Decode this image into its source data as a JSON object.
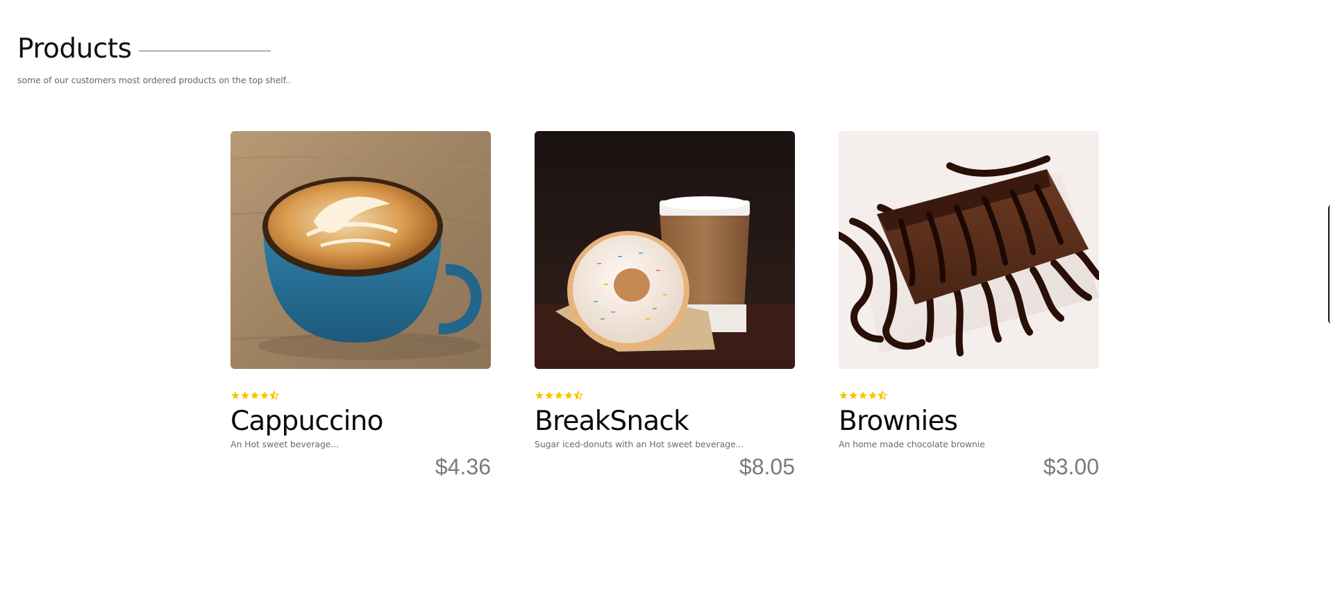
{
  "section": {
    "title": "Products",
    "subtitle": "some of our customers most ordered products on the top shelf.."
  },
  "colors": {
    "star": "#f5c400",
    "price": "#7a7a7a",
    "title": "#111111",
    "muted": "#666666"
  },
  "products": [
    {
      "name": "Cappuccino",
      "description": "An Hot sweet beverage...",
      "price": "$4.36",
      "rating": 4.5,
      "image": "latte-art-coffee-cup-icon"
    },
    {
      "name": "BreakSnack",
      "description": "Sugar iced-donuts with an Hot sweet beverage...",
      "price": "$8.05",
      "rating": 4.5,
      "image": "donut-and-coffee-cup-icon"
    },
    {
      "name": "Brownies",
      "description": "An home made chocolate brownie",
      "price": "$3.00",
      "rating": 4.5,
      "image": "chocolate-brownie-icon"
    }
  ]
}
